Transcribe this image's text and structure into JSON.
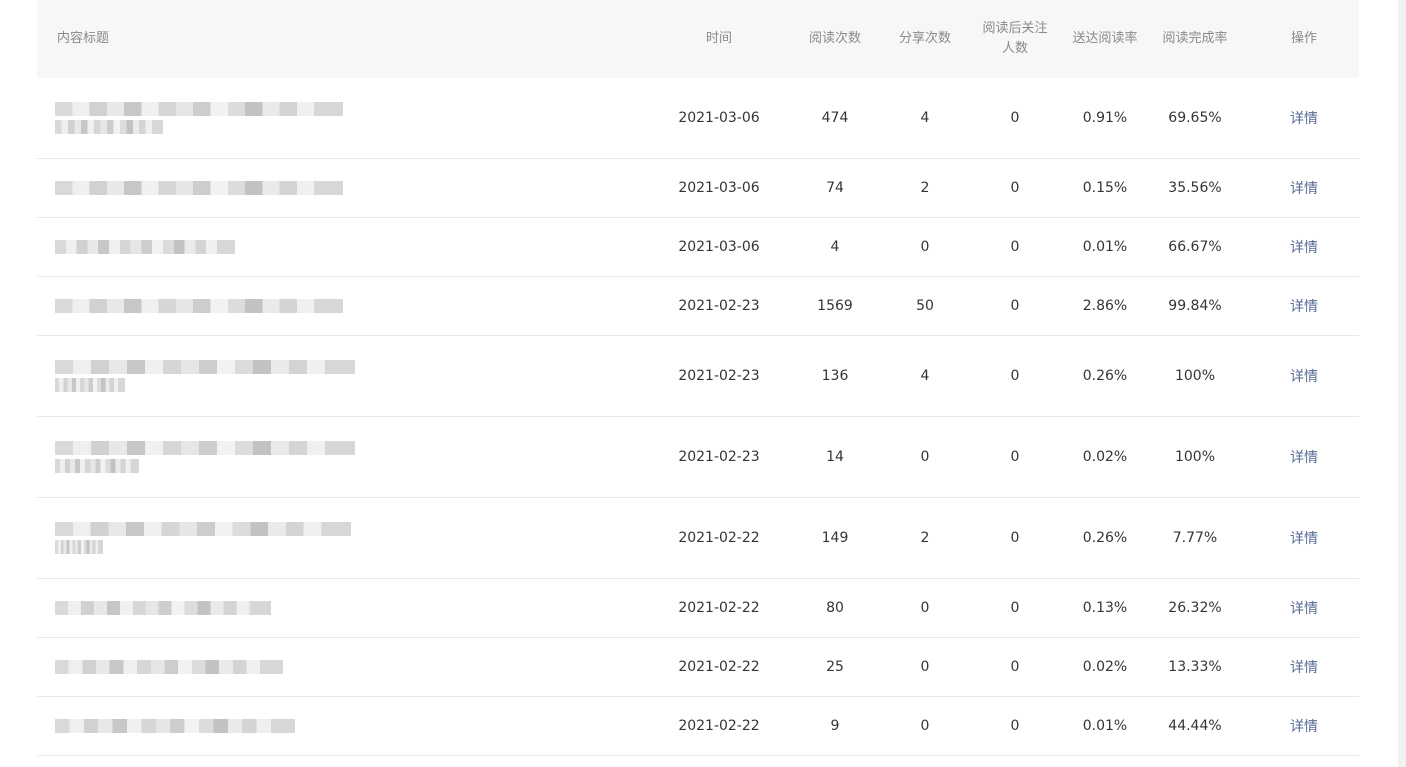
{
  "table": {
    "headers": {
      "title": "内容标题",
      "time": "时间",
      "reads": "阅读次数",
      "shares": "分享次数",
      "follow_line1": "阅读后关注",
      "follow_line2": "人数",
      "delivery_rate": "送达阅读率",
      "completion_rate": "阅读完成率",
      "action": "操作"
    },
    "rows": [
      {
        "date": "2021-03-06",
        "reads": "474",
        "shares": "4",
        "follows": "0",
        "delivery": "0.91%",
        "completion": "69.65%",
        "action": "详情",
        "title_suffix": ""
      },
      {
        "date": "2021-03-06",
        "reads": "74",
        "shares": "2",
        "follows": "0",
        "delivery": "0.15%",
        "completion": "35.56%",
        "action": "详情",
        "title_suffix": ""
      },
      {
        "date": "2021-03-06",
        "reads": "4",
        "shares": "0",
        "follows": "0",
        "delivery": "0.01%",
        "completion": "66.67%",
        "action": "详情",
        "title_suffix": ""
      },
      {
        "date": "2021-02-23",
        "reads": "1569",
        "shares": "50",
        "follows": "0",
        "delivery": "2.86%",
        "completion": "99.84%",
        "action": "详情",
        "title_suffix": ""
      },
      {
        "date": "2021-02-23",
        "reads": "136",
        "shares": "4",
        "follows": "0",
        "delivery": "0.26%",
        "completion": "100%",
        "action": "详情",
        "title_suffix": ""
      },
      {
        "date": "2021-02-23",
        "reads": "14",
        "shares": "0",
        "follows": "0",
        "delivery": "0.02%",
        "completion": "100%",
        "action": "详情",
        "title_suffix": ""
      },
      {
        "date": "2021-02-22",
        "reads": "149",
        "shares": "2",
        "follows": "0",
        "delivery": "0.26%",
        "completion": "7.77%",
        "action": "详情",
        "title_suffix": ""
      },
      {
        "date": "2021-02-22",
        "reads": "80",
        "shares": "0",
        "follows": "0",
        "delivery": "0.13%",
        "completion": "26.32%",
        "action": "详情",
        "title_suffix": ""
      },
      {
        "date": "2021-02-22",
        "reads": "25",
        "shares": "0",
        "follows": "0",
        "delivery": "0.02%",
        "completion": "13.33%",
        "action": "详情",
        "title_suffix": ""
      },
      {
        "date": "2021-02-22",
        "reads": "9",
        "shares": "0",
        "follows": "0",
        "delivery": "0.01%",
        "completion": "44.44%",
        "action": "详情",
        "title_suffix": ""
      }
    ]
  }
}
